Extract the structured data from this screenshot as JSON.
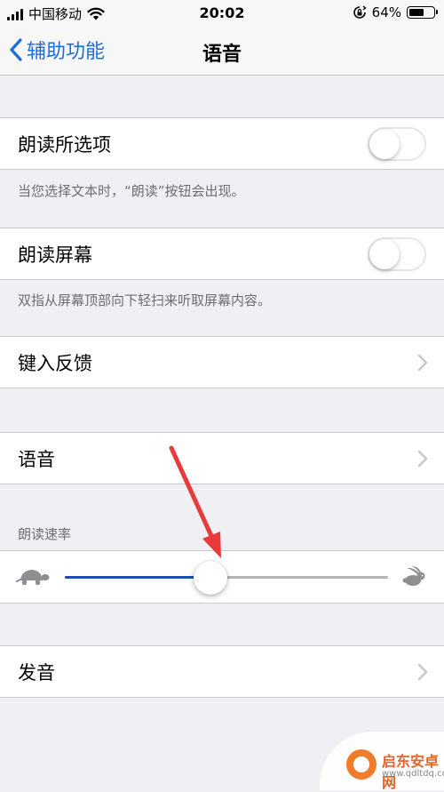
{
  "status_bar": {
    "carrier": "中国移动",
    "time": "20:02",
    "battery_text": "64%",
    "battery_level": 0.64
  },
  "nav": {
    "back_label": "辅助功能",
    "title": "语音"
  },
  "speak_selection": {
    "label": "朗读所选项",
    "enabled": false,
    "footer": "当您选择文本时，“朗读”按钮会出现。"
  },
  "speak_screen": {
    "label": "朗读屏幕",
    "enabled": false,
    "footer": "双指从屏幕顶部向下轻扫来听取屏幕内容。"
  },
  "typing_feedback": {
    "label": "键入反馈"
  },
  "voices": {
    "label": "语音"
  },
  "speaking_rate": {
    "header": "朗读速率",
    "value": 0.5
  },
  "pronunciation": {
    "label": "发音"
  },
  "watermark": {
    "name": "启东安卓网",
    "url": "www.qdltdq.com"
  },
  "colors": {
    "accent": "#1a6fe0",
    "slider_fill": "#1f4fa8",
    "annotation_arrow": "#e8393b"
  },
  "icons": {
    "back": "chevron-left-icon",
    "disclosure": "chevron-right-icon",
    "slow": "turtle-icon",
    "fast": "rabbit-icon",
    "wifi": "wifi-icon",
    "rotation_lock": "rotation-lock-icon"
  }
}
